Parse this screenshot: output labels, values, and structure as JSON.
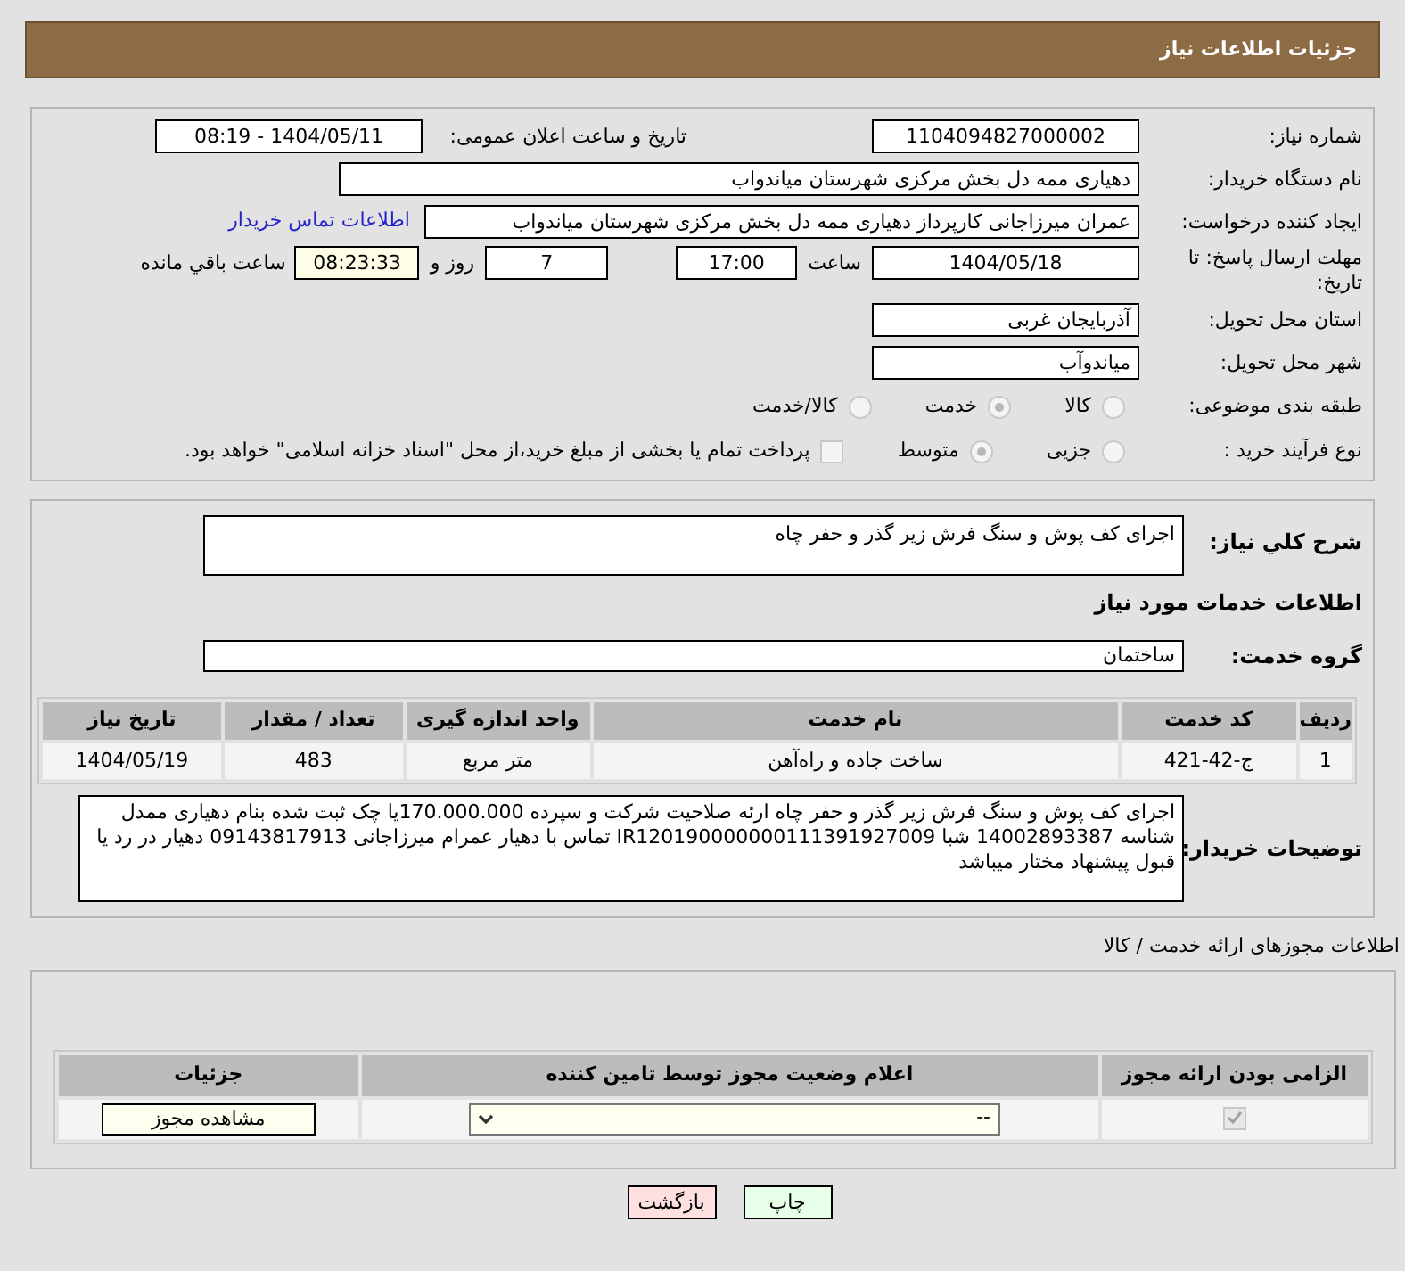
{
  "header": {
    "title": "جزئیات اطلاعات نیاز"
  },
  "need_number": {
    "label": "شماره نیاز:",
    "value": "1104094827000002"
  },
  "announce": {
    "label": "تاریخ و ساعت اعلان عمومی:",
    "value": "1404/05/11 - 08:19"
  },
  "buyer_org": {
    "label": "نام دستگاه خریدار:",
    "value": "دهیاری ممه دل بخش مرکزی شهرستان میاندواب"
  },
  "requester": {
    "label": "ایجاد کننده درخواست:",
    "value": "عمران میرزاجانی کارپرداز دهیاری ممه دل بخش مرکزی شهرستان میاندواب",
    "link": "اطلاعات تماس خریدار"
  },
  "deadline": {
    "label": "مهلت ارسال پاسخ: تا تاریخ:",
    "date": "1404/05/18",
    "time_label": "ساعت",
    "time": "17:00",
    "days": "7",
    "days_label": "روز و",
    "remaining": "08:23:33",
    "remaining_label": "ساعت باقي مانده"
  },
  "province": {
    "label": "استان محل تحویل:",
    "value": "آذربایجان غربی"
  },
  "city": {
    "label": "شهر محل تحویل:",
    "value": "میاندوآب"
  },
  "category": {
    "label": "طبقه بندی موضوعی:",
    "options": [
      {
        "label": "كالا",
        "selected": false
      },
      {
        "label": "خدمت",
        "selected": true
      },
      {
        "label": "كالا/خدمت",
        "selected": false
      }
    ]
  },
  "purchase_type": {
    "label": "نوع فرآیند خرید :",
    "options": [
      {
        "label": "جزیی",
        "selected": false
      },
      {
        "label": "متوسط",
        "selected": true
      }
    ],
    "payment_note": {
      "label": "پرداخت تمام یا بخشی از مبلغ خرید،از محل \"اسناد خزانه اسلامی\" خواهد بود.",
      "checked": false
    }
  },
  "summary": {
    "label": "شرح کلي نیاز:",
    "value": "اجرای کف پوش و سنگ فرش زیر گذر و حفر چاه"
  },
  "services_heading": "اطلاعات خدمات مورد نیاز",
  "service_group": {
    "label": "گروه خدمت:",
    "value": "ساختمان"
  },
  "services_table": {
    "columns": [
      "ردیف",
      "کد خدمت",
      "نام خدمت",
      "واحد اندازه گیری",
      "تعداد / مقدار",
      "تاریخ نیاز"
    ],
    "rows": [
      [
        "1",
        "ج-42-421",
        "ساخت جاده و راه‌آهن",
        "متر مربع",
        "483",
        "1404/05/19"
      ]
    ]
  },
  "buyer_notes": {
    "label": "توضیحات خریدار:",
    "value": "اجرای کف پوش و سنگ فرش زیر گذر و حفر چاه ارئه صلاحیت شرکت و سپرده 170.000.000یا چک ثبت شده بنام دهیاری ممدل شناسه 14002893387 شبا IR120190000000111391927009 تماس با دهیار عمرام میرزاجانی 09143817913 دهیار در رد یا قبول پیشنهاد مختار میباشد"
  },
  "licenses_heading": "اطلاعات مجوزهای ارائه خدمت / کالا",
  "licenses_table": {
    "columns": [
      "الزامی بودن ارائه مجوز",
      "اعلام وضعیت مجوز توسط تامین کننده",
      "جزئیات"
    ],
    "rows": [
      {
        "required": true,
        "status": "--",
        "action": "مشاهده مجوز"
      }
    ]
  },
  "buttons": [
    {
      "kind": "print",
      "label": "چاپ"
    },
    {
      "kind": "back",
      "label": "بازگشت"
    }
  ]
}
